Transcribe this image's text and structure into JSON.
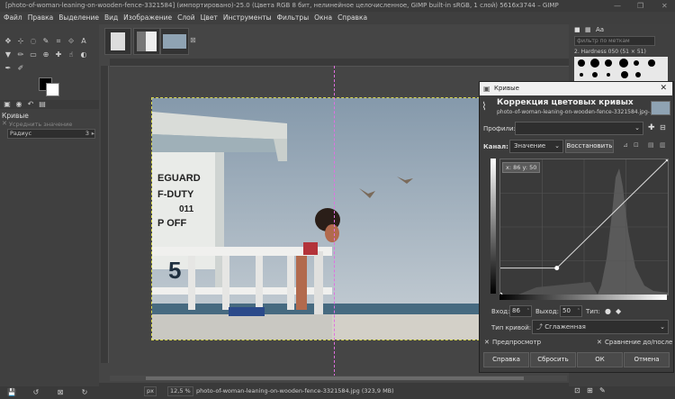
{
  "window": {
    "title": "[photo-of-woman-leaning-on-wooden-fence-3321584] (импортировано)-25.0 (Цвета RGB 8 бит, нелинейное целочисленное, GIMP built-in sRGB, 1 слой) 5616x3744 – GIMP"
  },
  "menu": [
    "Файл",
    "Правка",
    "Выделение",
    "Вид",
    "Изображение",
    "Слой",
    "Цвет",
    "Инструменты",
    "Фильтры",
    "Окна",
    "Справка"
  ],
  "tool_options": {
    "title": "Кривые",
    "sub": "Усреднить значение",
    "radius_label": "Радиус",
    "radius_value": "3"
  },
  "status": {
    "unit": "px",
    "zoom": "12,5 %",
    "file": "photo-of-woman-leaning-on-wooden-fence-3321584.jpg (323,9 MB)"
  },
  "brushes": {
    "filter_placeholder": "фильтр по меткам",
    "current": "2. Hardness 050 (51 × 51)"
  },
  "image_text": {
    "sign1": "EGUARD",
    "sign2": "F-DUTY",
    "sign3": "011",
    "sign4": "P OFF",
    "number": "5"
  },
  "dialog": {
    "title": "Кривые",
    "heading": "Коррекция цветовых кривых",
    "subheading": "photo-of-woman-leaning-on-wooden-fence-3321584.jpg-...",
    "profiles_label": "Профили:",
    "channel_label": "Канал:",
    "channel_value": "Значение",
    "restore_button": "Восстановить",
    "readout": "x: 86 y: 50",
    "input_label": "Вход:",
    "input_value": "86",
    "output_label": "Выход:",
    "output_value": "50",
    "type_label": "Тип:",
    "curve_type_label": "Тип кривой:",
    "curve_type_value": "Сглаженная",
    "preview_label": "Предпросмотр",
    "split_label": "Сравнение до/после",
    "help_button": "Справка",
    "reset_button": "Сбросить",
    "ok_button": "ОК",
    "cancel_button": "Отмена"
  },
  "curve_points": [
    [
      0,
      0
    ],
    [
      86,
      50
    ],
    [
      255,
      255
    ]
  ]
}
